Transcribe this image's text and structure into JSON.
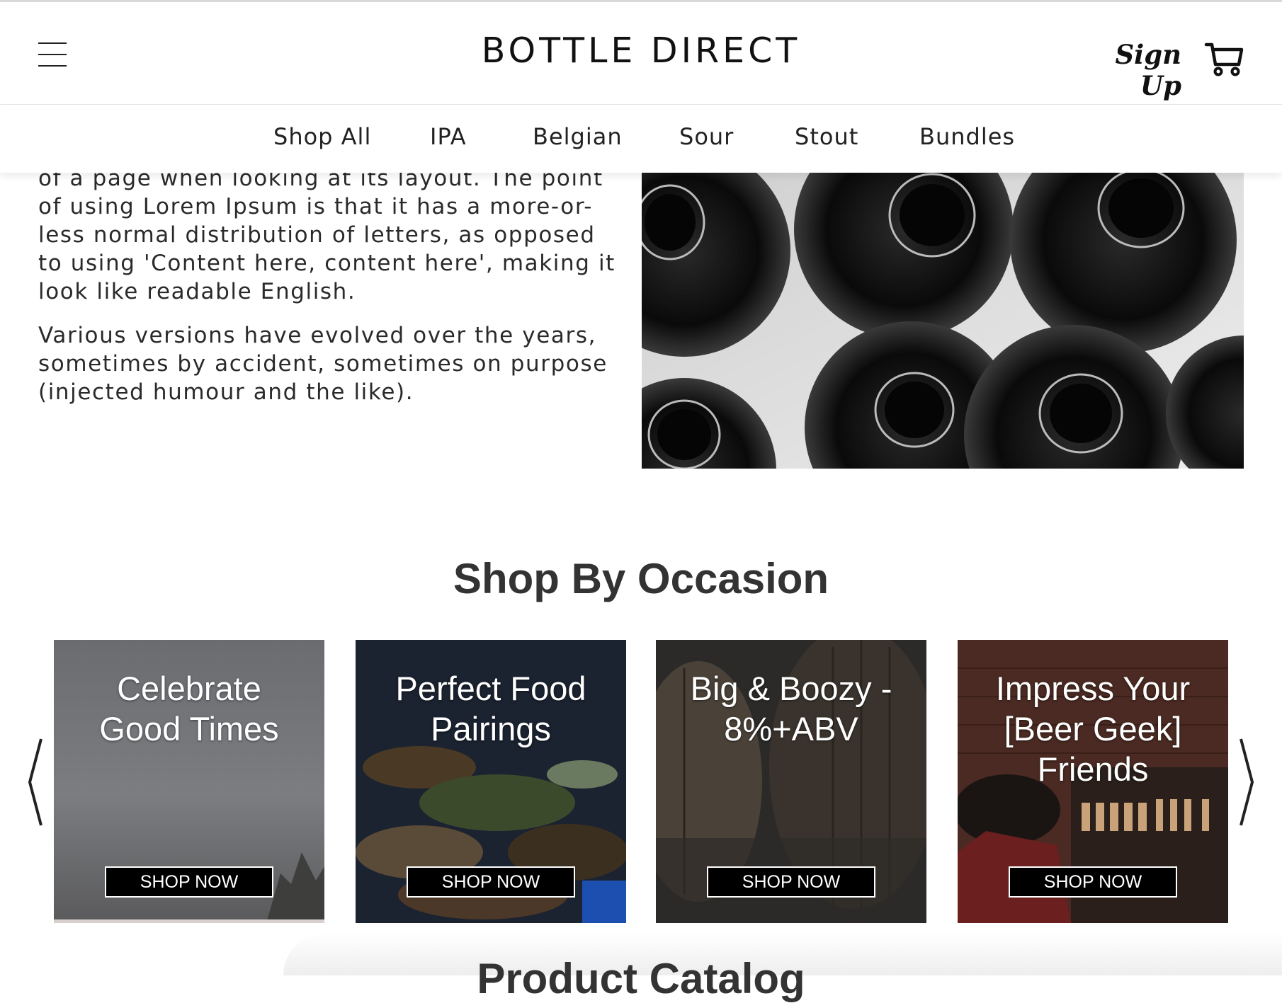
{
  "header": {
    "brand": "BOTTLE DIRECT",
    "sign_up": "Sign Up"
  },
  "nav": {
    "items": [
      {
        "label": "Shop All"
      },
      {
        "label": "IPA"
      },
      {
        "label": "Belgian"
      },
      {
        "label": "Sour"
      },
      {
        "label": "Stout"
      },
      {
        "label": "Bundles"
      }
    ]
  },
  "intro": {
    "paragraph1": "of a page when looking at its layout. The point of using Lorem Ipsum is that it has a more-or-less normal distribution of letters, as opposed to using 'Content here, content here', making it look like readable English.",
    "paragraph2": "Various versions have evolved over the years, sometimes by accident, sometimes on purpose (injected humour and the like)."
  },
  "occasion": {
    "title": "Shop By Occasion",
    "cards": [
      {
        "title": "Celebrate\nGood Times",
        "button": "SHOP NOW"
      },
      {
        "title": "Perfect Food\nPairings",
        "button": "SHOP NOW"
      },
      {
        "title": "Big & Boozy -\n8%+ABV",
        "button": "SHOP NOW"
      },
      {
        "title": "Impress Your\n[Beer Geek]\nFriends",
        "button": "SHOP NOW"
      }
    ]
  },
  "catalog": {
    "title": "Product Catalog"
  },
  "colors": {
    "text": "#222222",
    "button_bg": "#000000",
    "button_border": "#ffffff"
  },
  "icons": [
    "hamburger-menu-icon",
    "cart-icon",
    "chevron-left-icon",
    "chevron-right-icon"
  ]
}
